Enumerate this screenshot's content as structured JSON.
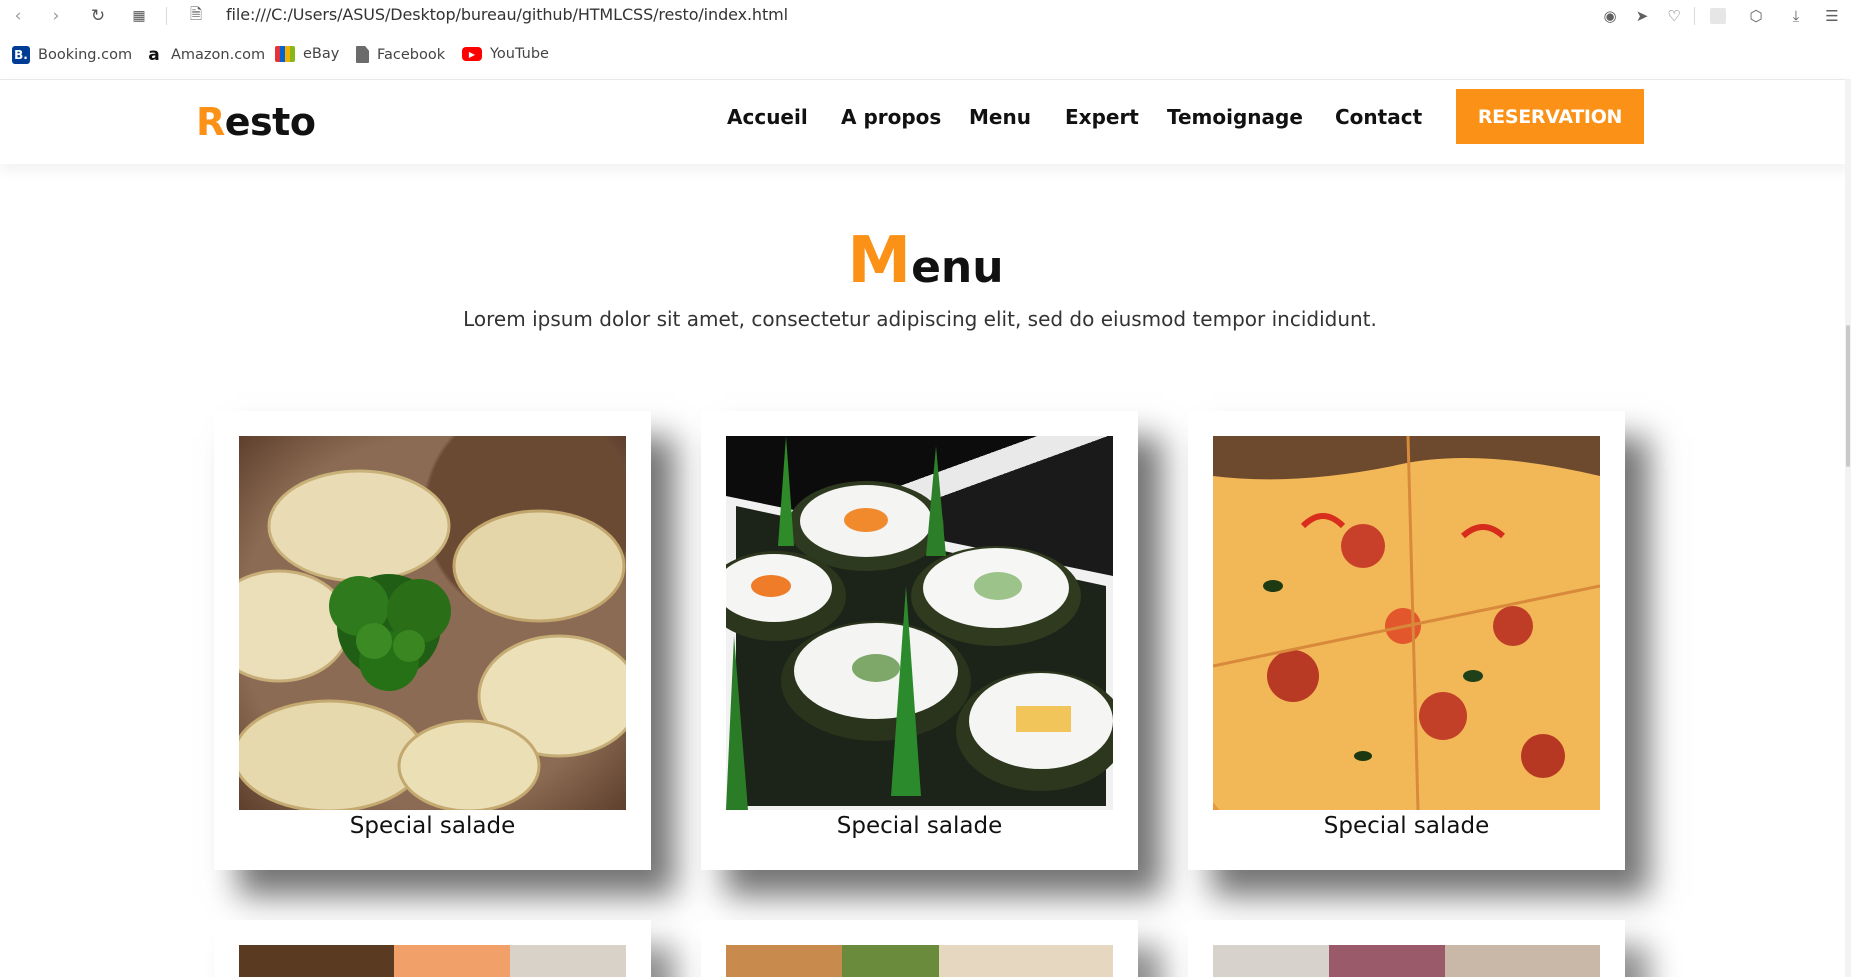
{
  "browser": {
    "url": "file:///C:/Users/ASUS/Desktop/bureau/github/HTMLCSS/resto/index.html",
    "bookmarks": [
      {
        "label": "Booking.com",
        "icon": "booking-icon"
      },
      {
        "label": "Amazon.com",
        "icon": "amazon-icon"
      },
      {
        "label": "eBay",
        "icon": "ebay-icon"
      },
      {
        "label": "Facebook",
        "icon": "file-icon"
      },
      {
        "label": "YouTube",
        "icon": "youtube-icon"
      }
    ]
  },
  "header": {
    "logo_first": "R",
    "logo_rest": "esto",
    "nav": [
      "Accueil",
      "A propos",
      "Menu",
      "Expert",
      "Temoignage",
      "Contact"
    ],
    "cta": "RESERVATION"
  },
  "menu_section": {
    "title_first": "M",
    "title_rest": "enu",
    "subtitle": "Lorem ipsum dolor sit amet, consectetur adipiscing elit, sed do eiusmod tempor incididunt."
  },
  "cards": [
    {
      "caption": "Special salade",
      "image": "dumplings"
    },
    {
      "caption": "Special salade",
      "image": "sushi"
    },
    {
      "caption": "Special salade",
      "image": "pizza"
    }
  ],
  "colors": {
    "accent": "#fb9117",
    "text": "#111111"
  }
}
